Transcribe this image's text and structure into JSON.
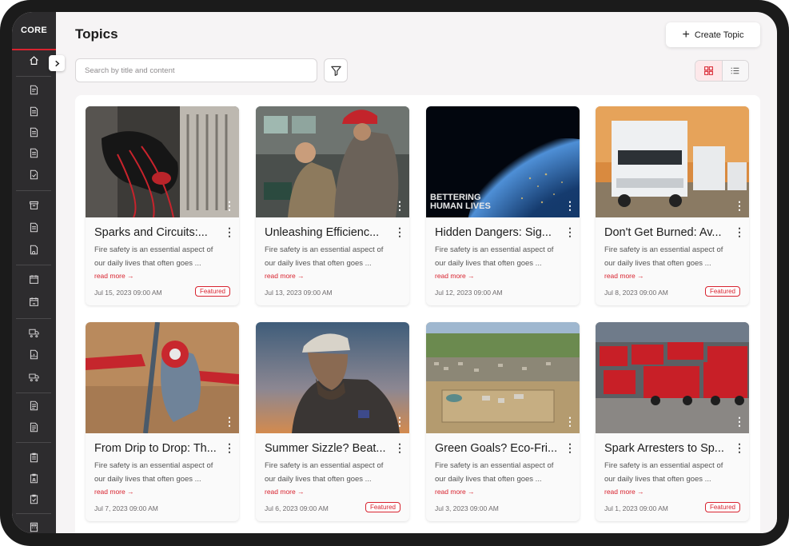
{
  "app": {
    "logo_text": "CORE"
  },
  "page": {
    "title": "Topics"
  },
  "toolbar": {
    "create_label": "Create Topic",
    "search_placeholder": "Search by title and content",
    "filter_icon": "filter-icon",
    "views": {
      "grid": "grid-view-icon",
      "list": "list-view-icon"
    }
  },
  "colors": {
    "accent": "#d8232f",
    "sidebar": "#2d2c2e",
    "background": "#f6f4f5"
  },
  "topics": [
    {
      "title": "Sparks and Circuits:...",
      "desc_1": "Fire safety is an essential aspect of",
      "desc_2": "our daily lives that often goes ...",
      "read_more": "read more →",
      "date": "Jul 15, 2023 09:00 AM",
      "badge": "Featured"
    },
    {
      "title": "Unleashing Efficienc...",
      "desc_1": "Fire safety is an essential aspect of",
      "desc_2": "our daily lives that often goes ...",
      "read_more": "read more →",
      "date": "Jul 13, 2023 09:00 AM",
      "badge": ""
    },
    {
      "title": "Hidden Dangers: Sig...",
      "desc_1": "Fire safety is an essential aspect of",
      "desc_2": "our daily lives that often goes ...",
      "read_more": "read more →",
      "date": "Jul 12, 2023 09:00 AM",
      "badge": "",
      "image_text_1": "BETTERING",
      "image_text_2": "HUMAN LIVES"
    },
    {
      "title": "Don't Get Burned: Av...",
      "desc_1": "Fire safety is an essential aspect of",
      "desc_2": "our daily lives that often goes ...",
      "read_more": "read more →",
      "date": "Jul 8, 2023 09:00 AM",
      "badge": "Featured"
    },
    {
      "title": "From Drip to Drop: Th...",
      "desc_1": "Fire safety is an essential aspect of",
      "desc_2": "our daily lives that often goes ...",
      "read_more": "read more →",
      "date": "Jul 7, 2023 09:00 AM",
      "badge": ""
    },
    {
      "title": "Summer Sizzle? Beat...",
      "desc_1": "Fire safety is an essential aspect of",
      "desc_2": "our daily lives that often goes ...",
      "read_more": "read more →",
      "date": "Jul 6, 2023 09:00 AM",
      "badge": "Featured"
    },
    {
      "title": "Green Goals? Eco-Fri...",
      "desc_1": "Fire safety is an essential aspect of",
      "desc_2": "our daily lives that often goes ...",
      "read_more": "read more →",
      "date": "Jul 3, 2023 09:00 AM",
      "badge": ""
    },
    {
      "title": "Spark Arresters to Sp...",
      "desc_1": "Fire safety is an essential aspect of",
      "desc_2": "our daily lives that often goes ...",
      "read_more": "read more →",
      "date": "Jul 1, 2023 09:00 AM",
      "badge": "Featured"
    }
  ]
}
